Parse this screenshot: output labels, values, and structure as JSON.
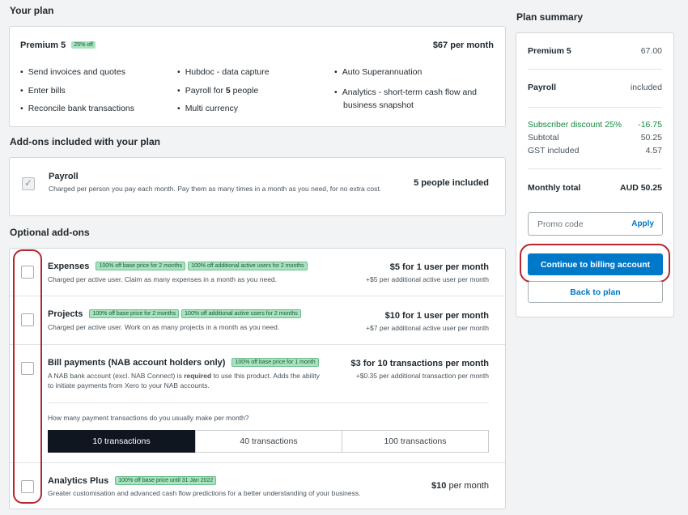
{
  "plan": {
    "section_title": "Your plan",
    "name": "Premium 5",
    "badge": "25% off",
    "price": "$67 per month",
    "features_col1": [
      "Send invoices and quotes",
      "Enter bills",
      "Reconcile bank transactions"
    ],
    "features_col2_a": "Hubdoc - data capture",
    "features_col2_b_pre": "Payroll for ",
    "features_col2_b_num": "5",
    "features_col2_b_post": " people",
    "features_col2_c": "Multi currency",
    "features_col3_a": "Auto Superannuation",
    "features_col3_b": "Analytics - short-term cash flow and business snapshot"
  },
  "included": {
    "section_title": "Add-ons included with your plan",
    "title": "Payroll",
    "desc": "Charged per person you pay each month. Pay them as many times in a month as you need, for no extra cost.",
    "right": "5 people included"
  },
  "optional": {
    "section_title": "Optional add-ons",
    "expenses": {
      "title": "Expenses",
      "badge1": "100% off base price for 2 months",
      "badge2": "100% off additional active users for 2 months",
      "desc": "Charged per active user. Claim as many expenses in a month as you need.",
      "price": "$5 for 1 user per month",
      "price_sub": "+$5 per additional active user per month"
    },
    "projects": {
      "title": "Projects",
      "badge1": "100% off base price for 2 months",
      "badge2": "100% off additional active users for 2 months",
      "desc": "Charged per active user. Work on as many projects in a month as you need.",
      "price": "$10 for 1 user per month",
      "price_sub": "+$7 per additional active user per month"
    },
    "bill": {
      "title": "Bill payments (NAB account holders only)",
      "badge1": "100% off base price for 1 month",
      "desc_pre": "A NAB bank account (excl. NAB Connect) is ",
      "desc_bold": "required",
      "desc_post": " to use this product. Adds the ability to initiate payments from Xero to your NAB accounts.",
      "price": "$3 for 10 transactions per month",
      "price_sub": "+$0.35 per additional transaction per month",
      "question": "How many payment transactions do you usually make per month?",
      "options": [
        "10 transactions",
        "40 transactions",
        "100 transactions"
      ]
    },
    "analytics": {
      "title": "Analytics Plus",
      "badge1": "100% off base price until 31 Jan 2022",
      "desc": "Greater customisation and advanced cash flow predictions for a better understanding of your business.",
      "price_bold": "$10",
      "price_rest": " per month"
    }
  },
  "summary": {
    "title": "Plan summary",
    "plan_name": "Premium 5",
    "plan_price": "67.00",
    "payroll": "Payroll",
    "payroll_val": "included",
    "discount_label": "Subscriber discount 25%",
    "discount_val": "-16.75",
    "subtotal_label": "Subtotal",
    "subtotal_val": "50.25",
    "gst_label": "GST included",
    "gst_val": "4.57",
    "total_label": "Monthly total",
    "total_val": "AUD 50.25",
    "promo_placeholder": "Promo code",
    "apply": "Apply",
    "continue": "Continue to billing account",
    "back": "Back to plan"
  },
  "colors": {
    "primary": "#0078c8",
    "discount": "#138a3e",
    "annotation": "#b6262c",
    "badge": "#a8e2bf"
  }
}
